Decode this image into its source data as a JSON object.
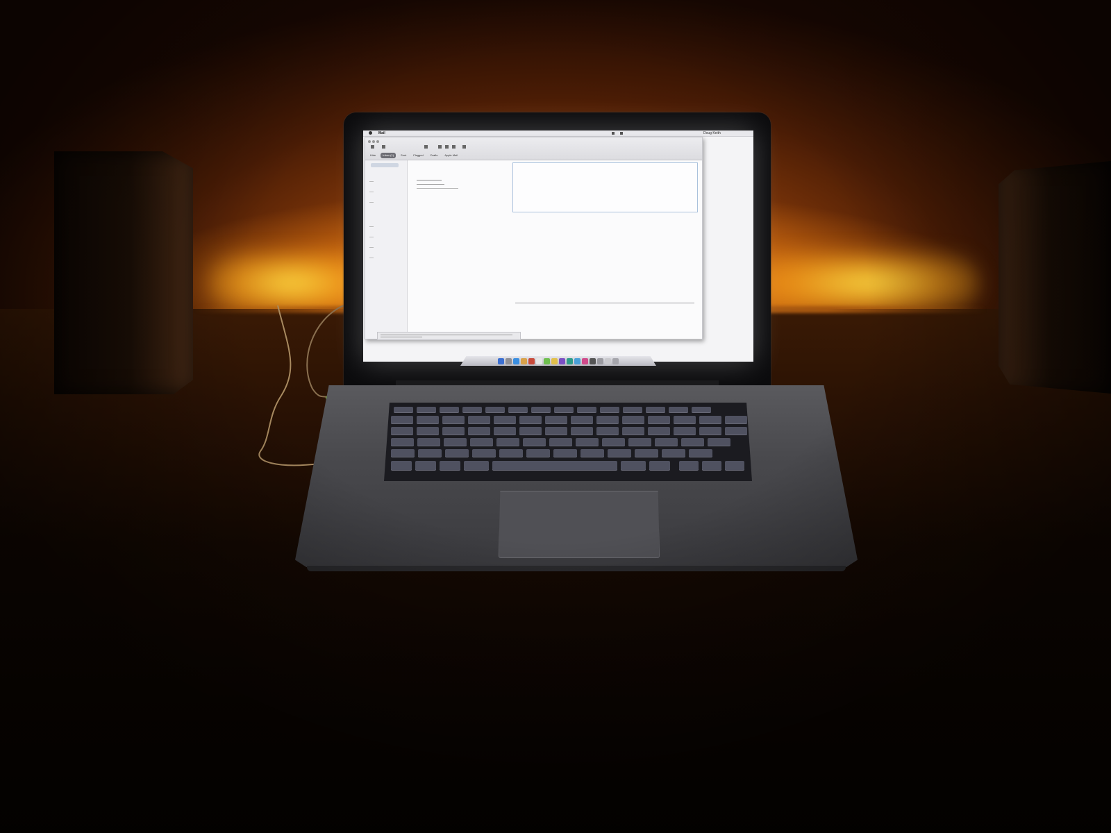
{
  "scene": {
    "description_colors": {
      "backlight": "#ffb42a",
      "wall": "#8a3c0a",
      "desk": "#2a1204",
      "screen": "#f4f4f6"
    }
  },
  "screen": {
    "menubar": {
      "app_name": "Mail",
      "user_name": "Doug Keith"
    },
    "toolbar": {
      "filters": [
        {
          "label": "Hide",
          "active": false
        },
        {
          "label": "Inbox (1)",
          "active": true
        },
        {
          "label": "Sent",
          "active": false
        },
        {
          "label": "Flagged",
          "active": false
        },
        {
          "label": "Drafts",
          "active": false
        },
        {
          "label": "Apple Mail",
          "active": false
        }
      ]
    }
  }
}
